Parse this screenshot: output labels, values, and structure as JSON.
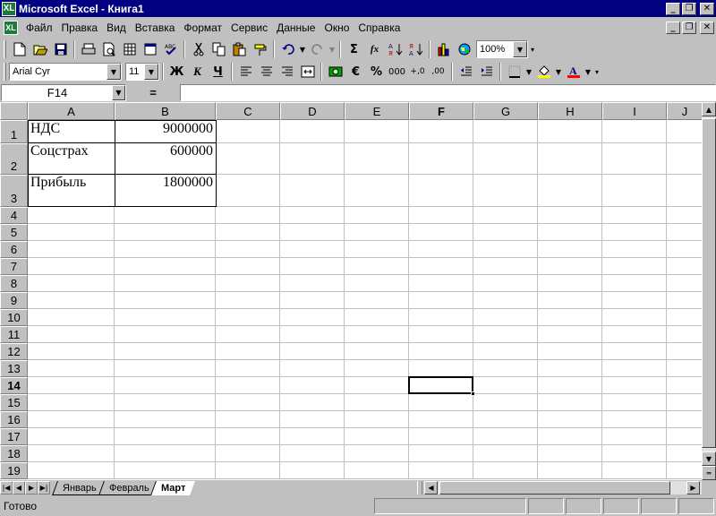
{
  "window": {
    "title": "Microsoft Excel - Книга1",
    "app_icon": "XL",
    "controls": [
      "_",
      "❐",
      "✕"
    ]
  },
  "menu": {
    "items": [
      "Файл",
      "Правка",
      "Вид",
      "Вставка",
      "Формат",
      "Сервис",
      "Данные",
      "Окно",
      "Справка"
    ]
  },
  "toolbar_standard": {
    "zoom": "100%",
    "icons": [
      "new-icon",
      "open-icon",
      "save-icon",
      "print-icon",
      "print-preview-icon",
      "table-icon",
      "window-icon",
      "spelling-icon",
      "cut-icon",
      "copy-icon",
      "paste-icon",
      "format-painter-icon",
      "undo-icon",
      "redo-icon",
      "autosum-icon",
      "function-icon",
      "sort-ascending-icon",
      "sort-descending-icon",
      "chart-wizard-icon",
      "map-icon"
    ],
    "autosum_glyph": "Σ",
    "function_glyph": "fx"
  },
  "toolbar_format": {
    "font": "Arial Cyr",
    "size": "11",
    "bold": "Ж",
    "italic": "К",
    "underline": "Ч",
    "currency": "€",
    "percent": "%",
    "thousands": "000",
    "inc_decimal": "+,0",
    "dec_decimal": ",00"
  },
  "formula_bar": {
    "name_box": "F14",
    "equals": "=",
    "value": ""
  },
  "sheet": {
    "columns": [
      "A",
      "B",
      "C",
      "D",
      "E",
      "F",
      "G",
      "H",
      "I",
      "J"
    ],
    "active_column": "F",
    "rows": [
      "1",
      "2",
      "3",
      "4",
      "5",
      "6",
      "7",
      "8",
      "9",
      "10",
      "11",
      "12",
      "13",
      "14",
      "15",
      "16",
      "17",
      "18",
      "19"
    ],
    "active_row": "14",
    "data": [
      {
        "label": "НДС",
        "value": "9000000"
      },
      {
        "label": "Соцстрах",
        "value": "600000"
      },
      {
        "label": "Прибыль",
        "value": "1800000"
      }
    ]
  },
  "tabs": {
    "sheets": [
      "Январь",
      "Февраль",
      "Март"
    ],
    "active": "Март"
  },
  "status": {
    "text": "Готово"
  },
  "colors": {
    "titlebar": "#000080",
    "face": "#c0c0c0"
  }
}
